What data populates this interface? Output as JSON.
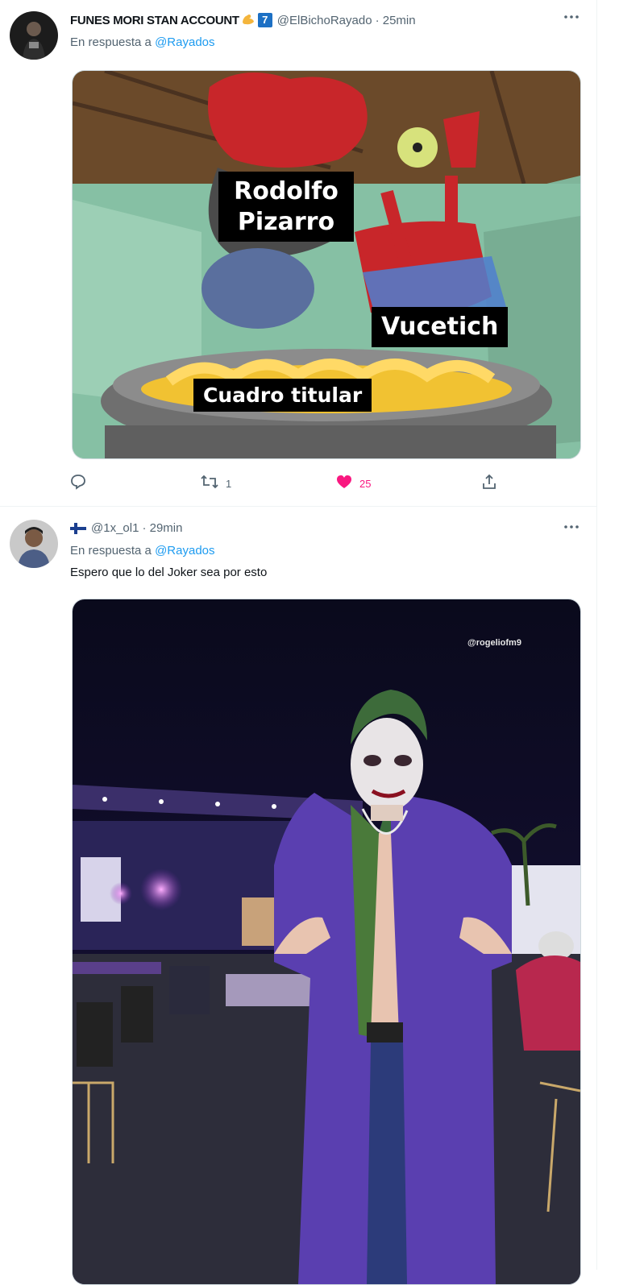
{
  "tweets": [
    {
      "display_name": "FUNES MORI STAN ACCOUNT",
      "badge": "7",
      "handle": "@ElBichoRayado",
      "time": "· 25min",
      "reply_prefix": "En respuesta a",
      "reply_mention": "@Rayados",
      "media_labels": [
        "Rodolfo Pizarro",
        "Vucetich",
        "Cuadro titular"
      ],
      "actions": {
        "retweets": "1",
        "likes": "25"
      }
    },
    {
      "handle": "@1x_ol1",
      "time": "· 29min",
      "reply_prefix": "En respuesta a",
      "reply_mention": "@Rayados",
      "text": "Espero que lo del Joker sea por esto",
      "watermark": "@rogeliofm9"
    }
  ],
  "icons": {
    "more": "more-icon",
    "reply": "reply-icon",
    "retweet": "retweet-icon",
    "like": "heart-icon",
    "share": "share-icon",
    "flag": "finland-flag-icon"
  },
  "colors": {
    "accent": "#1d9bf0",
    "like": "#f91880",
    "secondary_text": "#536471"
  }
}
